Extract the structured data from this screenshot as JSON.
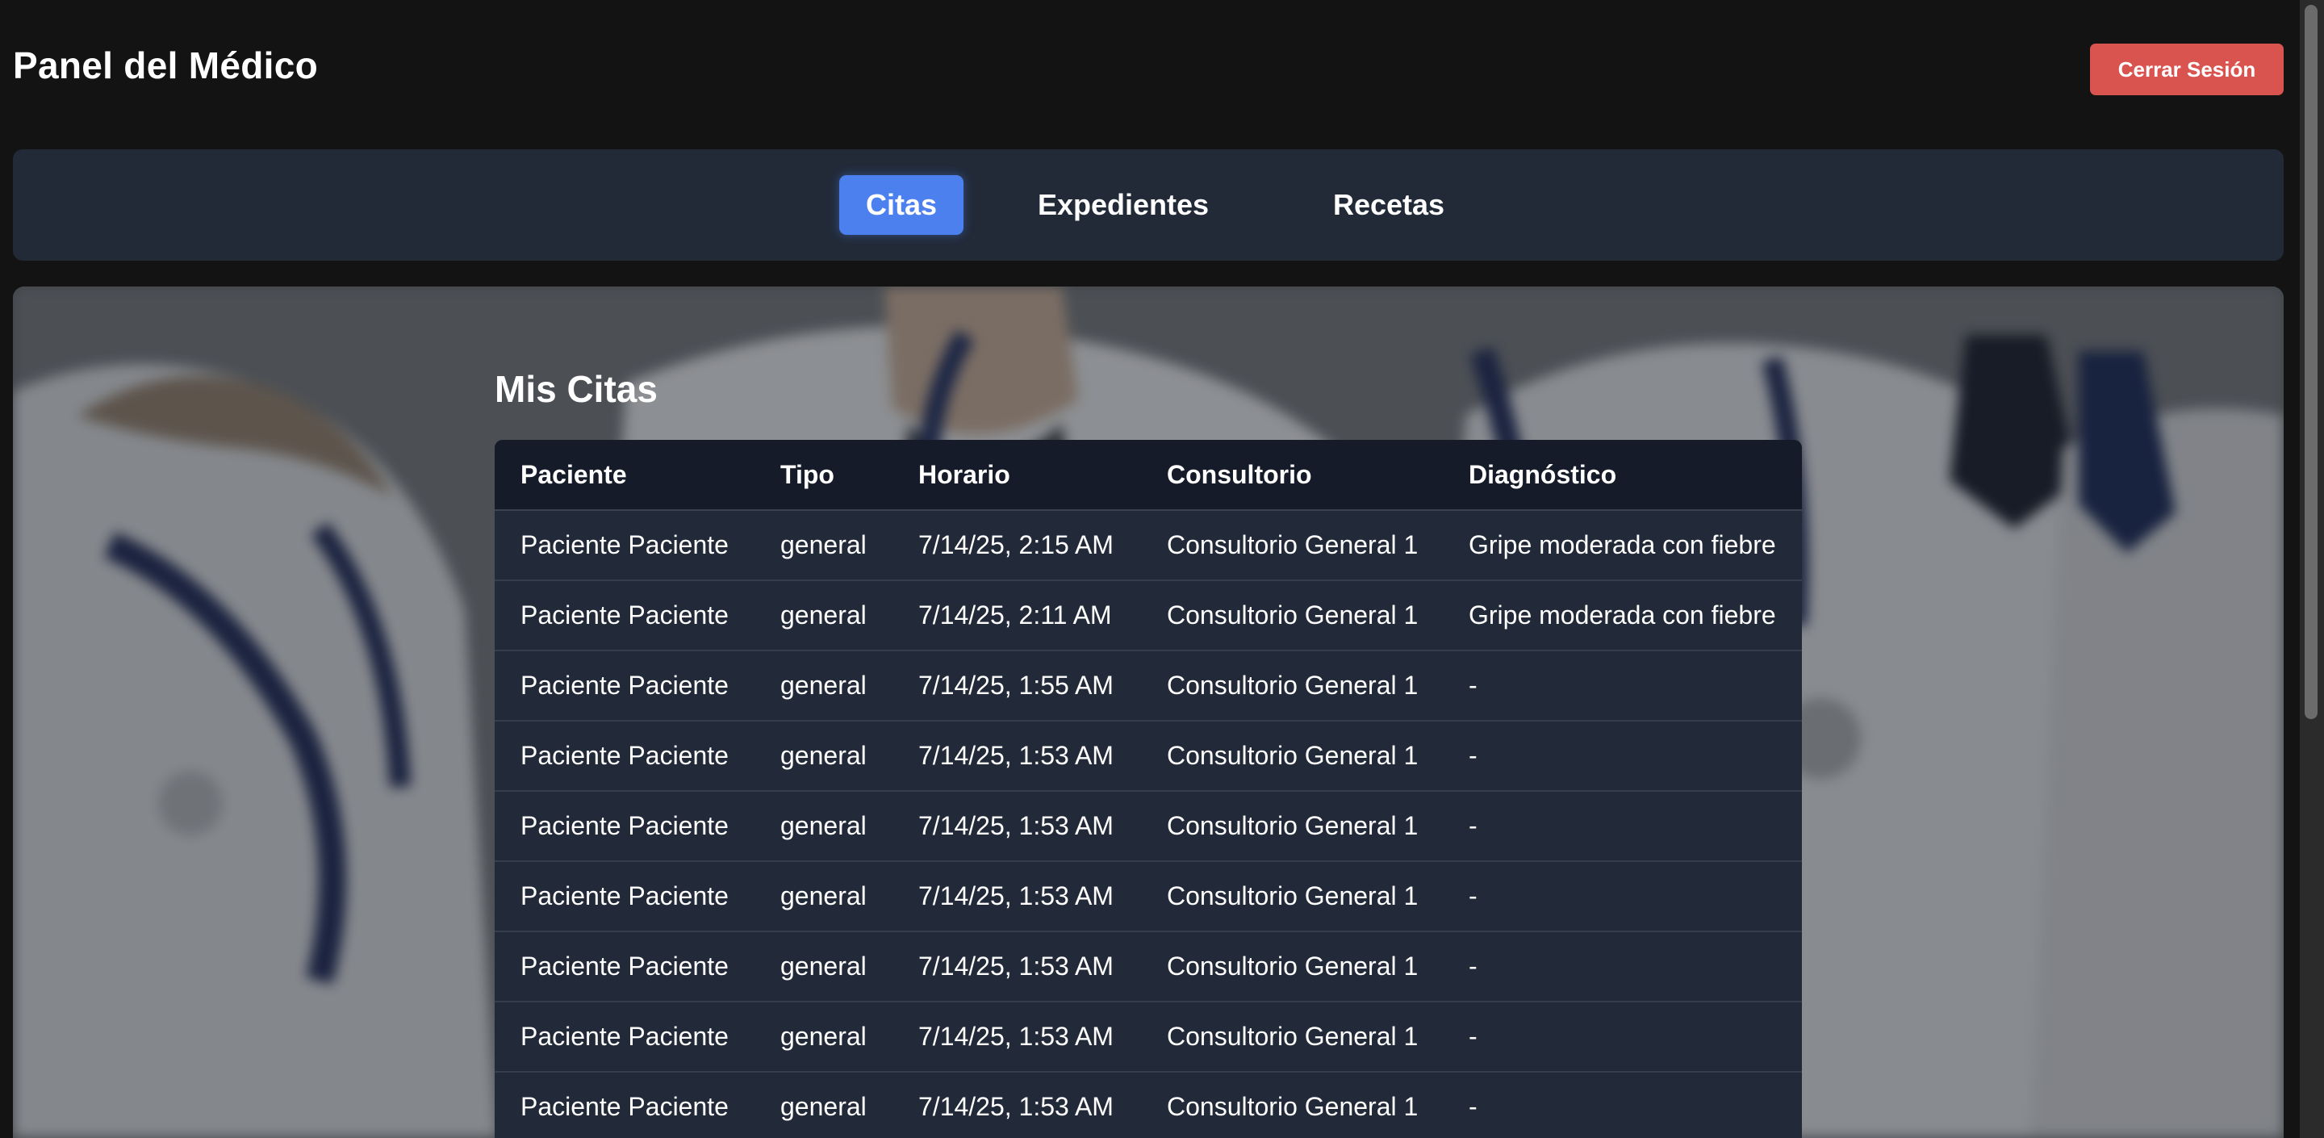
{
  "header": {
    "title": "Panel del Médico",
    "logout_label": "Cerrar Sesión"
  },
  "nav": {
    "tabs": [
      {
        "label": "Citas",
        "active": true
      },
      {
        "label": "Expedientes",
        "active": false
      },
      {
        "label": "Recetas",
        "active": false
      }
    ]
  },
  "main": {
    "section_title": "Mis Citas",
    "columns": [
      "Paciente",
      "Tipo",
      "Horario",
      "Consultorio",
      "Diagnóstico"
    ],
    "rows": [
      [
        "Paciente Paciente",
        "general",
        "7/14/25, 2:15 AM",
        "Consultorio General 1",
        "Gripe moderada con fiebre"
      ],
      [
        "Paciente Paciente",
        "general",
        "7/14/25, 2:11 AM",
        "Consultorio General 1",
        "Gripe moderada con fiebre"
      ],
      [
        "Paciente Paciente",
        "general",
        "7/14/25, 1:55 AM",
        "Consultorio General 1",
        "-"
      ],
      [
        "Paciente Paciente",
        "general",
        "7/14/25, 1:53 AM",
        "Consultorio General 1",
        "-"
      ],
      [
        "Paciente Paciente",
        "general",
        "7/14/25, 1:53 AM",
        "Consultorio General 1",
        "-"
      ],
      [
        "Paciente Paciente",
        "general",
        "7/14/25, 1:53 AM",
        "Consultorio General 1",
        "-"
      ],
      [
        "Paciente Paciente",
        "general",
        "7/14/25, 1:53 AM",
        "Consultorio General 1",
        "-"
      ],
      [
        "Paciente Paciente",
        "general",
        "7/14/25, 1:53 AM",
        "Consultorio General 1",
        "-"
      ],
      [
        "Paciente Paciente",
        "general",
        "7/14/25, 1:53 AM",
        "Consultorio General 1",
        "-"
      ]
    ]
  },
  "colors": {
    "accent": "#4c80ee",
    "danger": "#d9534f",
    "nav_bg": "#222a38",
    "table_header_bg": "#151b28",
    "table_body_bg": "#222938",
    "page_bg": "#131313"
  }
}
